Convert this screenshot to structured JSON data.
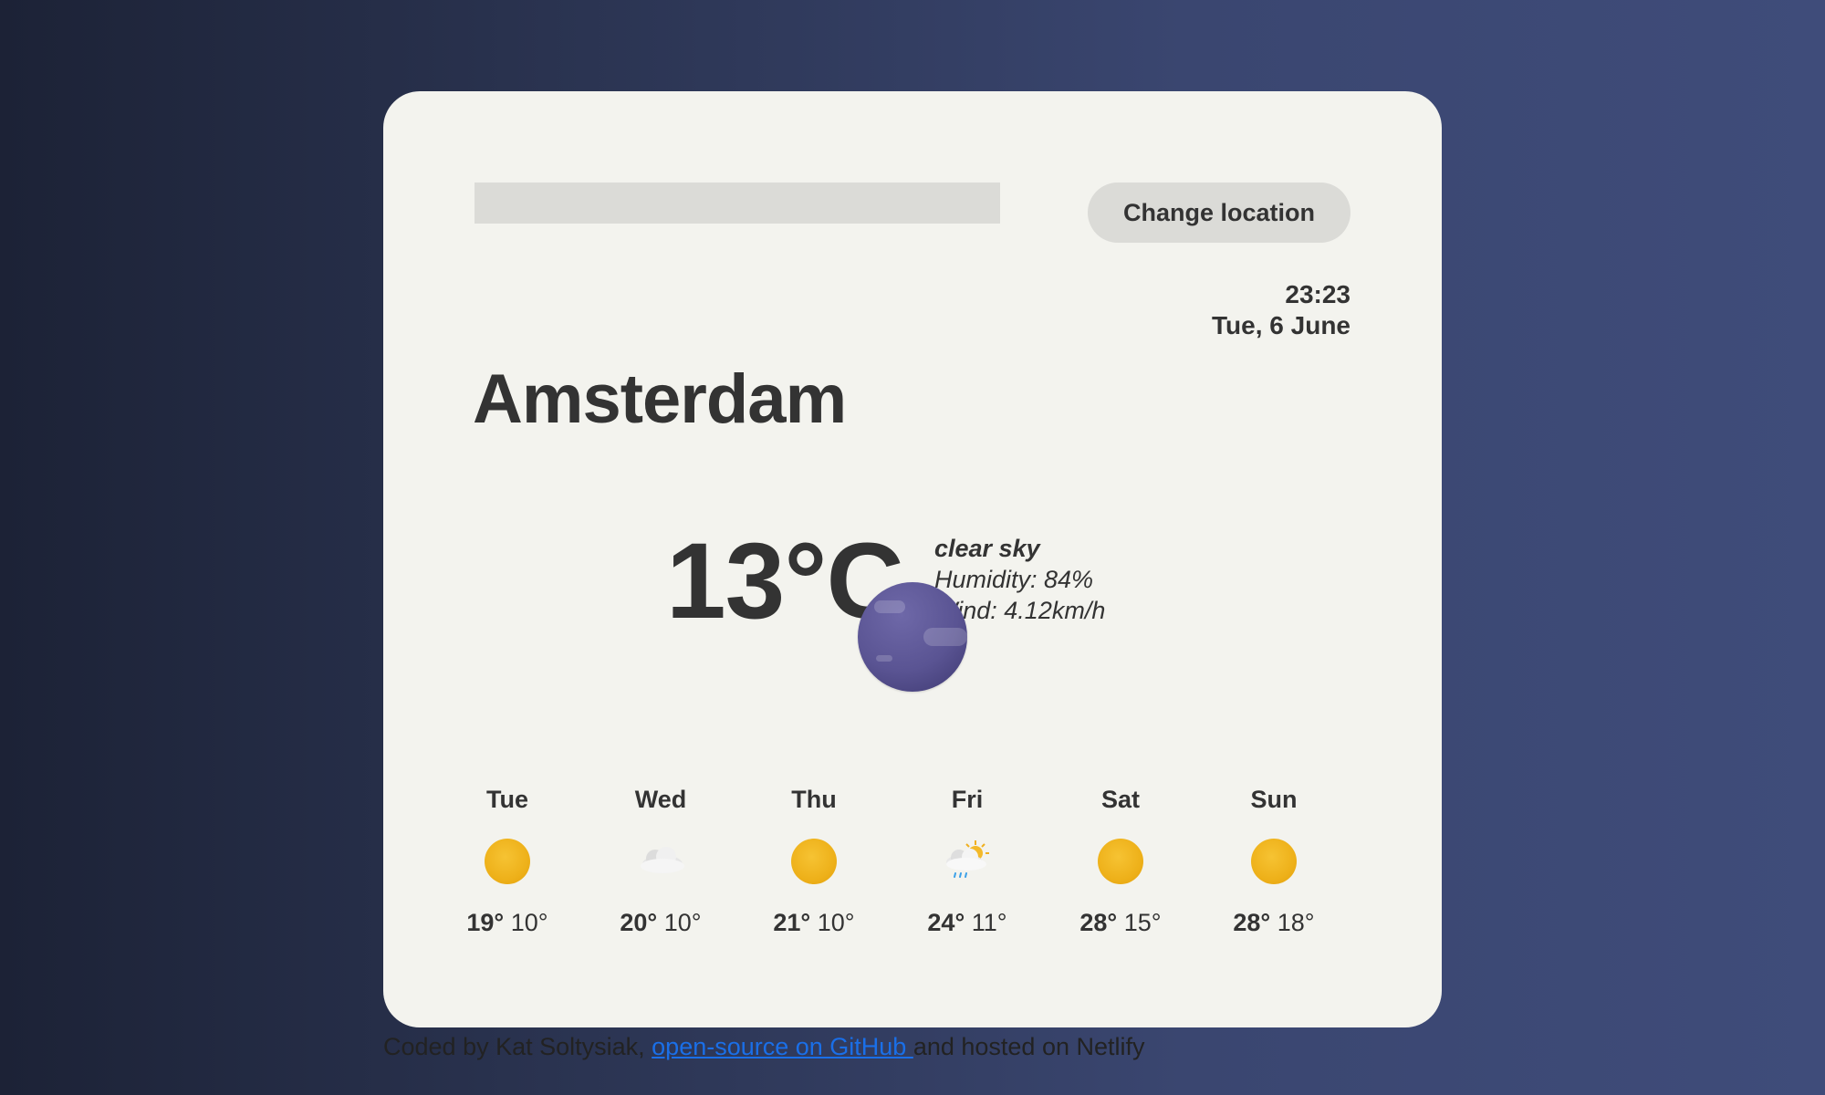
{
  "search": {
    "placeholder": ""
  },
  "change_location_label": "Change location",
  "city": "Amsterdam",
  "time": "23:23",
  "date": "Tue, 6 June",
  "current": {
    "temperature": "13°C",
    "description": "clear sky",
    "humidity": "Humidity: 84%",
    "wind": "Wind: 4.12km/h",
    "icon": "moon-icon"
  },
  "forecast": [
    {
      "day": "Tue",
      "icon": "sun-icon",
      "max": "19°",
      "min": "10°"
    },
    {
      "day": "Wed",
      "icon": "cloud-icon",
      "max": "20°",
      "min": "10°"
    },
    {
      "day": "Thu",
      "icon": "sun-icon",
      "max": "21°",
      "min": "10°"
    },
    {
      "day": "Fri",
      "icon": "sun-cloud-rain-icon",
      "max": "24°",
      "min": "11°"
    },
    {
      "day": "Sat",
      "icon": "sun-icon",
      "max": "28°",
      "min": "15°"
    },
    {
      "day": "Sun",
      "icon": "sun-icon",
      "max": "28°",
      "min": "18°"
    }
  ],
  "footer": {
    "prefix": "Coded by Kat Soltysiak, ",
    "link": "open-source on GitHub ",
    "suffix": "and hosted on Netlify"
  }
}
